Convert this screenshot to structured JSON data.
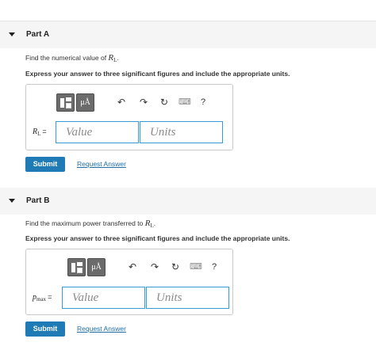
{
  "parts": [
    {
      "title": "Part A",
      "prompt_text": "Find the numerical value of ",
      "prompt_var": "R",
      "prompt_sub": "L",
      "prompt_end": ".",
      "instruction": "Express your answer to three significant figures and include the appropriate units.",
      "field_var": "R",
      "field_sub": "L",
      "field_eq": "=",
      "value_placeholder": "Value",
      "units_placeholder": "Units",
      "submit_label": "Submit",
      "request_label": "Request Answer"
    },
    {
      "title": "Part B",
      "prompt_text": "Find the maximum power transferred to ",
      "prompt_var": "R",
      "prompt_sub": "L",
      "prompt_end": ".",
      "instruction": "Express your answer to three significant figures and include the appropriate units.",
      "field_var": "p",
      "field_sub": "max",
      "field_eq": "=",
      "value_placeholder": "Value",
      "units_placeholder": "Units",
      "submit_label": "Submit",
      "request_label": "Request Answer"
    }
  ],
  "toolbar": {
    "template_icon": "templates-icon",
    "mu_label": "μÅ",
    "undo_glyph": "↶",
    "redo_glyph": "↷",
    "reset_glyph": "↻",
    "keyboard_glyph": "⌨",
    "help_glyph": "?"
  },
  "colors": {
    "accent": "#1f7bb5",
    "input_border": "#3a9ad3",
    "link": "#1f6fa6",
    "header_bg": "#f5f5f5"
  }
}
